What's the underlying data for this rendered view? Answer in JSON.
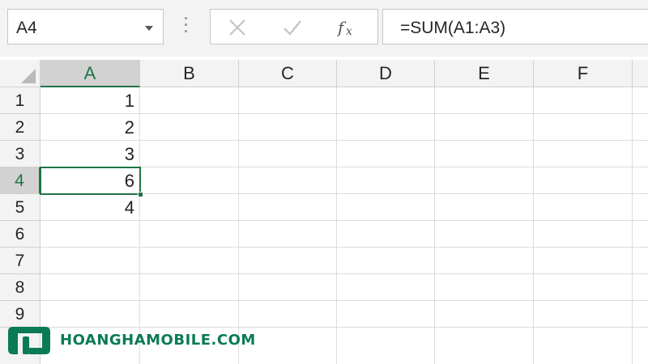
{
  "name_box": {
    "value": "A4"
  },
  "formula_bar": {
    "value": "=SUM(A1:A3)"
  },
  "columns": [
    "A",
    "B",
    "C",
    "D",
    "E",
    "F"
  ],
  "rows": [
    "1",
    "2",
    "3",
    "4",
    "5",
    "6",
    "7",
    "8",
    "9"
  ],
  "cells": {
    "A1": "1",
    "A2": "2",
    "A3": "3",
    "A4": "6",
    "A5": "4"
  },
  "selected_cell": "A4",
  "watermark": {
    "brand": "HOANGHAMOBILE.COM"
  },
  "colors": {
    "accent": "#217346",
    "header_bg": "#f3f3f3",
    "grid_line": "#dcdcdc",
    "watermark": "#0a7a57"
  },
  "icons": {
    "cancel": "close-icon",
    "enter": "checkmark-icon",
    "function": "fx-icon",
    "dropdown": "chevron-down-icon"
  }
}
